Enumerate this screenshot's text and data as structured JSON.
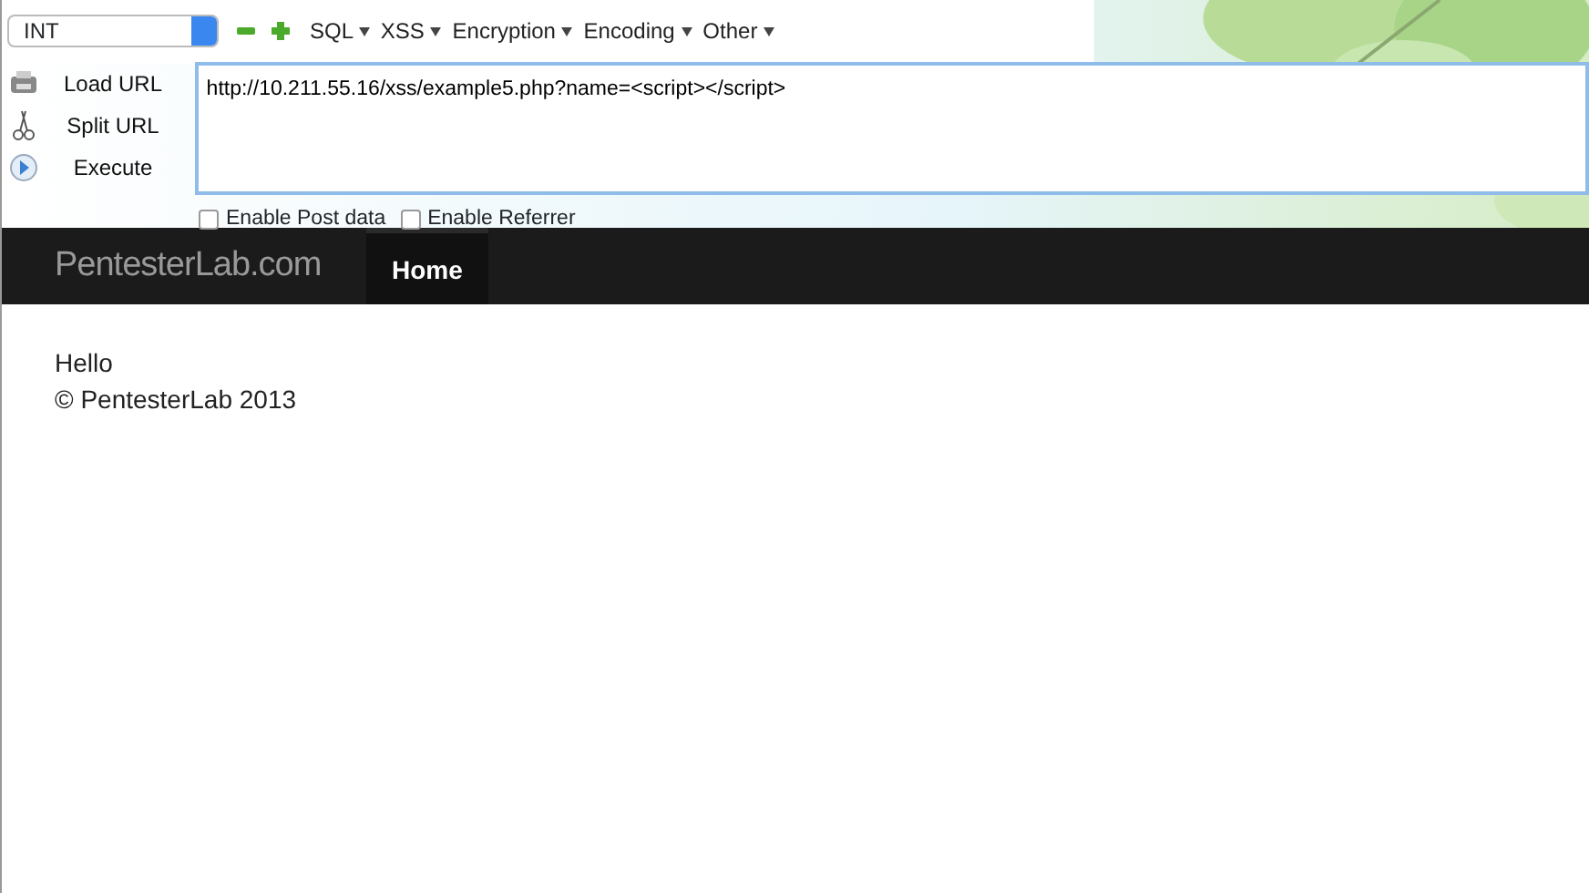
{
  "toolbar": {
    "select": {
      "value": "INT"
    },
    "menus": [
      {
        "label": "SQL"
      },
      {
        "label": "XSS"
      },
      {
        "label": "Encryption"
      },
      {
        "label": "Encoding"
      },
      {
        "label": "Other"
      }
    ],
    "actions": [
      {
        "kind": "load",
        "label": "Load URL"
      },
      {
        "kind": "split",
        "label": "Split URL"
      },
      {
        "kind": "execute",
        "label": "Execute"
      }
    ],
    "url": {
      "value": "http://10.211.55.16/xss/example5.php?name=<script></script>"
    },
    "options": [
      {
        "label": "Enable Post data",
        "checked": false
      },
      {
        "label": "Enable Referrer",
        "checked": false
      }
    ]
  },
  "navbar": {
    "brand": "PentesterLab.com",
    "links": [
      {
        "label": "Home",
        "selected": true
      }
    ]
  },
  "content": {
    "lines": [
      "Hello",
      "© PentesterLab 2013"
    ]
  }
}
